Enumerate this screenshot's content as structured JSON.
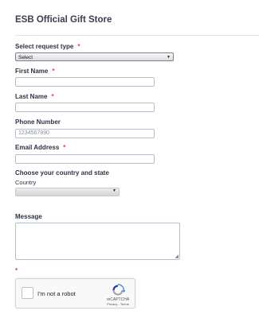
{
  "page": {
    "title": "ESB Official Gift Store"
  },
  "form": {
    "request_type": {
      "label": "Select request type",
      "required_mark": "*",
      "selected": "Select"
    },
    "first_name": {
      "label": "First Name",
      "required_mark": "*",
      "value": ""
    },
    "last_name": {
      "label": "Last Name",
      "required_mark": "*",
      "value": ""
    },
    "phone": {
      "label": "Phone Number",
      "placeholder": "1234567890"
    },
    "email": {
      "label": "Email Address",
      "required_mark": "*",
      "value": ""
    },
    "location": {
      "label": "Choose your country and state",
      "country_label": "Country",
      "country_selected": ""
    },
    "message": {
      "label": "Message",
      "value": ""
    },
    "captcha_required_mark": "*"
  },
  "captcha": {
    "label": "I'm not a robot",
    "brand": "reCAPTCHA",
    "links": "Privacy - Terms",
    "checked": false
  },
  "colors": {
    "required": "#e0405a",
    "text": "#2c3345",
    "border": "#b8bdc9"
  }
}
